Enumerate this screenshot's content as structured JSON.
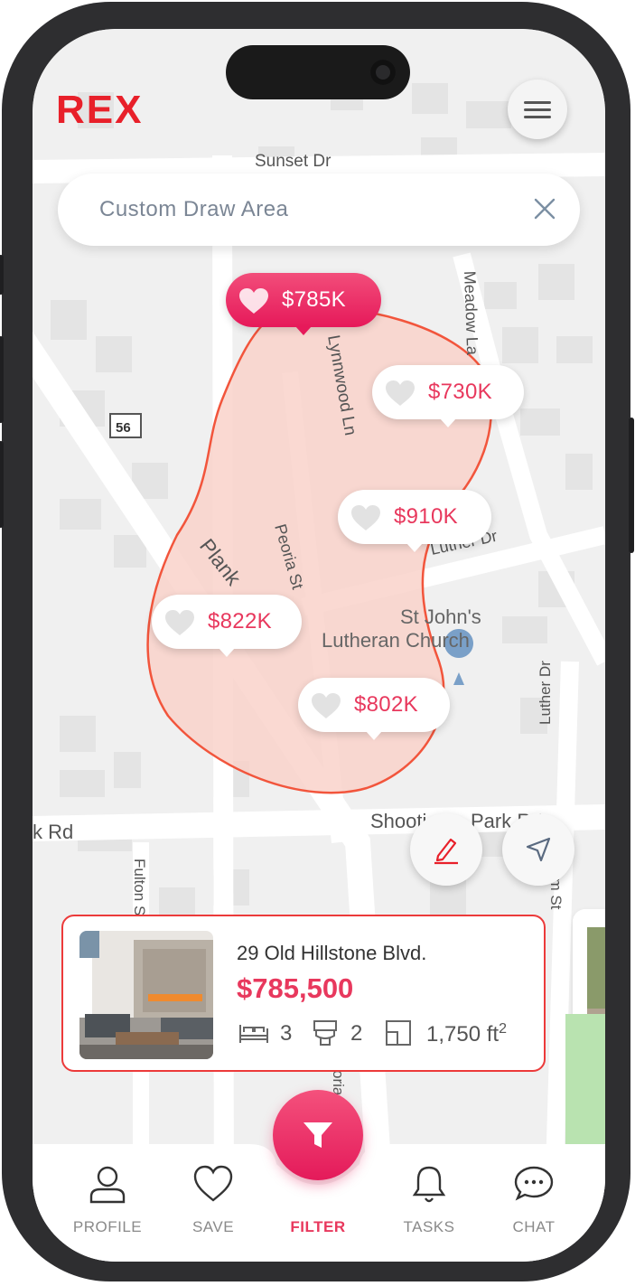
{
  "app": {
    "brand": "REX"
  },
  "colors": {
    "accent": "#e8385d",
    "card_border": "#ec3a3a",
    "draw_area_fill": "#f9d1c8",
    "draw_area_stroke": "#f2553c"
  },
  "search": {
    "placeholder": "Custom Draw Area"
  },
  "map": {
    "streets": [
      "Sunset Dr",
      "Lynnwood Ln",
      "Meadow La",
      "Plank",
      "Peoria St",
      "Luther Dr",
      "k Rd",
      "Shooti",
      "Park Rd",
      "Fulton St",
      "Luther Dr",
      "em St",
      "oria"
    ],
    "route_shield": "56",
    "place": {
      "line1": "St John's",
      "line2": "Lutheran Church"
    }
  },
  "pins": [
    {
      "price": "$785K",
      "active": true,
      "favorite": true
    },
    {
      "price": "$730K",
      "active": false,
      "favorite": false
    },
    {
      "price": "$910K",
      "active": false,
      "favorite": false
    },
    {
      "price": "$822K",
      "active": false,
      "favorite": false
    },
    {
      "price": "$802K",
      "active": false,
      "favorite": false
    }
  ],
  "listing": {
    "address": "29 Old Hillstone Blvd.",
    "price": "$785,500",
    "beds": "3",
    "baths": "2",
    "area": "1,750 ft",
    "area_unit_sup": "2"
  },
  "nav": {
    "items": [
      {
        "label": "PROFILE",
        "icon": "user-icon"
      },
      {
        "label": "SAVE",
        "icon": "heart-icon"
      },
      {
        "label": "FILTER",
        "icon": "filter-icon",
        "active": true
      },
      {
        "label": "TASKS",
        "icon": "bell-icon"
      },
      {
        "label": "CHAT",
        "icon": "chat-icon"
      }
    ]
  }
}
